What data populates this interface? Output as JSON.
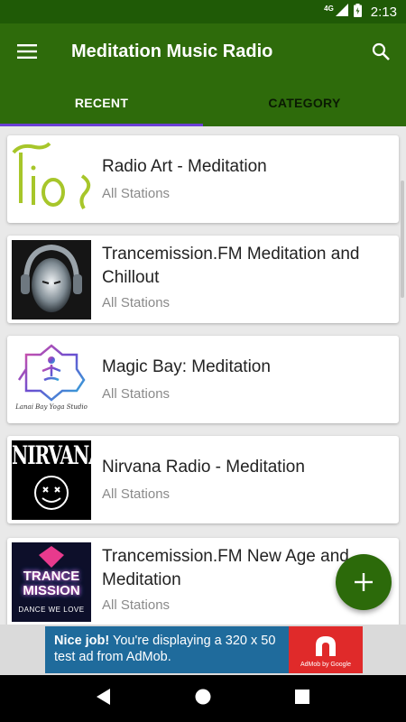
{
  "status_bar": {
    "network": "4G",
    "time": "2:13"
  },
  "app_bar": {
    "title": "Meditation Music Radio"
  },
  "tabs": [
    {
      "label": "RECENT",
      "active": true
    },
    {
      "label": "CATEGORY",
      "active": false
    }
  ],
  "stations": [
    {
      "name": "Radio Art - Meditation",
      "subtitle": "All Stations"
    },
    {
      "name": "Trancemission.FM Meditation and Chillout",
      "subtitle": "All Stations"
    },
    {
      "name": "Magic Bay: Meditation",
      "subtitle": "All Stations",
      "logo_text": "Lanai Bay Yoga Studio"
    },
    {
      "name": "Nirvana Radio - Meditation",
      "subtitle": "All Stations",
      "logo_text": "NIRVANA"
    },
    {
      "name": "Trancemission.FM New Age and Meditation",
      "subtitle": "All Stations",
      "logo_text": "TRANCE MISSION",
      "logo_tagline": "DANCE WE LOVE"
    }
  ],
  "ad": {
    "bold": "Nice job!",
    "text": " You're displaying a 320 x 50 test ad from AdMob.",
    "brand": "AdMob by Google"
  },
  "colors": {
    "app_bar": "#2e6b0b",
    "status_bar": "#1f5a06",
    "tab_indicator": "#6b3fd6",
    "fab": "#2c6a0a",
    "ad_background": "#1f6b9c"
  }
}
